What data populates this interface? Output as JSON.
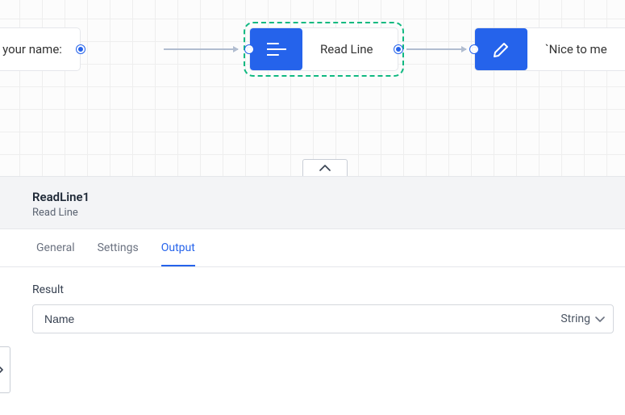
{
  "canvas": {
    "node1": {
      "label": "se tell me your name:"
    },
    "node2": {
      "label": "Read Line"
    },
    "node3": {
      "label": "`Nice to me"
    }
  },
  "panel": {
    "title": "ReadLine1",
    "subtitle": "Read Line"
  },
  "tabs": {
    "general": "General",
    "settings": "Settings",
    "output": "Output"
  },
  "output": {
    "result_label": "Result",
    "result_value": "Name",
    "result_type": "String"
  }
}
